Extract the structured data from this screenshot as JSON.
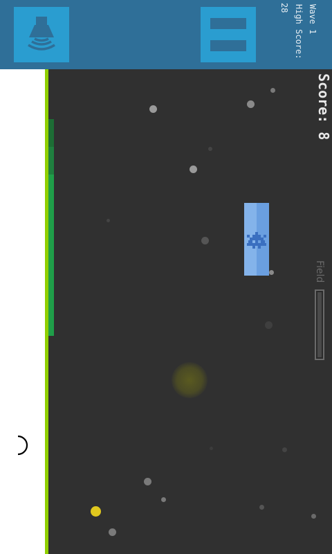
{
  "hud": {
    "wave_label": "Wave 1",
    "high_score_label": "High Score:",
    "high_score_value": "28",
    "score_text": "Score: 8",
    "field_label": "Field"
  },
  "buttons": {
    "sound_icon": "speaker-waves-icon",
    "pause_icon": "pause-icon"
  },
  "colors": {
    "topbar": "#2f6f98",
    "button": "#2a9dd0",
    "playfield": "#303030",
    "wall": "#8fcf00",
    "health": "#1f9e49",
    "enemy": "#6a9fe0",
    "coin": "#e0c81e"
  },
  "field_level": 0.0
}
